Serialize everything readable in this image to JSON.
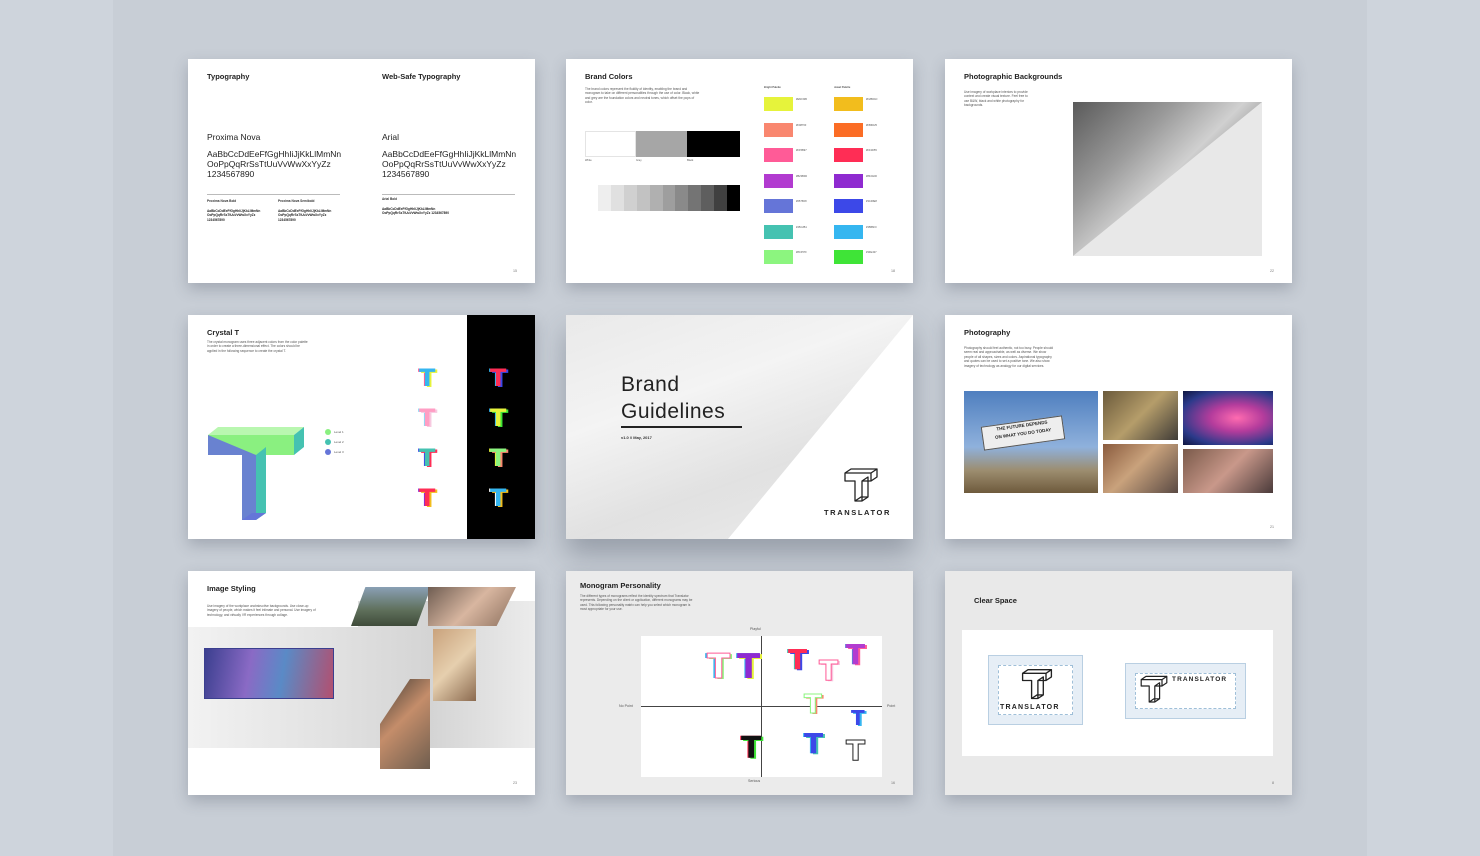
{
  "slides": {
    "typography": {
      "title": "Typography",
      "websafe_title": "Web-Safe Typography",
      "font1": "Proxima Nova",
      "font1_sample": "AaBbCcDdEeFfGgHhIiJjKkLlMmNn OoPpQqRrSsTtUuVvWwXxYyZz 1234567890",
      "font2": "Arial",
      "font2_sample": "AaBbCcDdEeFfGgHhIiJjKkLlMmNn OoPpQqRrSsTtUuVvWwXxYyZz 1234567890",
      "weight1": "Proxima Nova Bold",
      "weight2": "Proxima Nova Semibold",
      "weight3": "Arial Bold",
      "small_sample": "AaBbCcDdEeFfGgHhIiJjKkLlMmNn OoPpQqRrSsTtUuVvWwXxYyZz 1234567890",
      "page": "15"
    },
    "brand_colors": {
      "title": "Brand Colors",
      "body": "The brand colors represent the fluidity of identity, enabling the brand and monogram to take on different personalities through the use of color. Black, white and grey are the foundation colors and neutral tones, which offset the pops of color.",
      "bright_label": "Bright Palette",
      "jewel_label": "Jewel Palette",
      "neutral_labels": [
        "White",
        "Grey",
        "Black"
      ],
      "grey_steps": [
        "#ffffff",
        "#eeeeee",
        "#e0e0e0",
        "#d0d0d0",
        "#c2c2c2",
        "#b0b0b0",
        "#9e9e9e",
        "#8a8a8a",
        "#747474",
        "#5e5e5e",
        "#404040",
        "#000000"
      ],
      "bright": [
        "#e6f33b",
        "#f9876f",
        "#ff5b97",
        "#b23bd0",
        "#6575d8",
        "#45c2b1",
        "#8cf57f"
      ],
      "jewel": [
        "#f2bd1d",
        "#fb6d25",
        "#ff2d55",
        "#8f2ad0",
        "#3c48e8",
        "#35b6f0",
        "#3fe437"
      ],
      "page": "18"
    },
    "photo_backgrounds": {
      "title": "Photographic Backgrounds",
      "body": "Use imagery of workplace interiors to provide context and create visual texture. Feel free to use B&W, black and white photography for backgrounds.",
      "page": "22"
    },
    "crystal": {
      "title": "Crystal T",
      "body": "The crystal monogram uses three adjacent colors from the color palette in order to create a three-dimensional effect. The colors should be applied in the following sequence to create the crystal T.",
      "legend": [
        "Level 1",
        "Level 2",
        "Level 3"
      ],
      "legend_colors": [
        "#8af080",
        "#45c2b1",
        "#6575d8"
      ]
    },
    "cover": {
      "title_line1": "Brand",
      "title_line2": "Guidelines",
      "meta": "v1.0  //  May, 2017",
      "logo_text": "TRANSLATOR",
      "logo_letter": "T"
    },
    "photography": {
      "title": "Photography",
      "body": "Photography should feel authentic, not too busy. People should seem real and approachable, as well as diverse. We show people of all shapes, sizes and colors. Aspirational typography and quotes can be used to set a positive tone. We also show imagery of technology as analogy for our digital services.",
      "sign_text_1": "THE FUTURE DEPENDS",
      "sign_text_2": "ON WHAT YOU DO TODAY",
      "page": "21"
    },
    "image_styling": {
      "title": "Image Styling",
      "body": "Use imagery of the workplace unobstructive backgrounds. Use close-up imagery of people, which makes it feel intimate and personal. Use imagery of technology, and virtually VR experiences through collage.",
      "page": "23"
    },
    "monogram": {
      "title": "Monogram Personality",
      "body": "The different types of monograms reflect the identity spectrum that Translator represents. Depending on the client or application, different monograms may be used. This following personality matrix can help you select which monogram is most appropriate for your use.",
      "axis_top": "Playful",
      "axis_bottom": "Serious",
      "axis_left": "No Point",
      "axis_right": "Point",
      "page": "16"
    },
    "clear_space": {
      "title": "Clear Space",
      "logo_text": "TRANSLATOR",
      "page": "8"
    }
  }
}
